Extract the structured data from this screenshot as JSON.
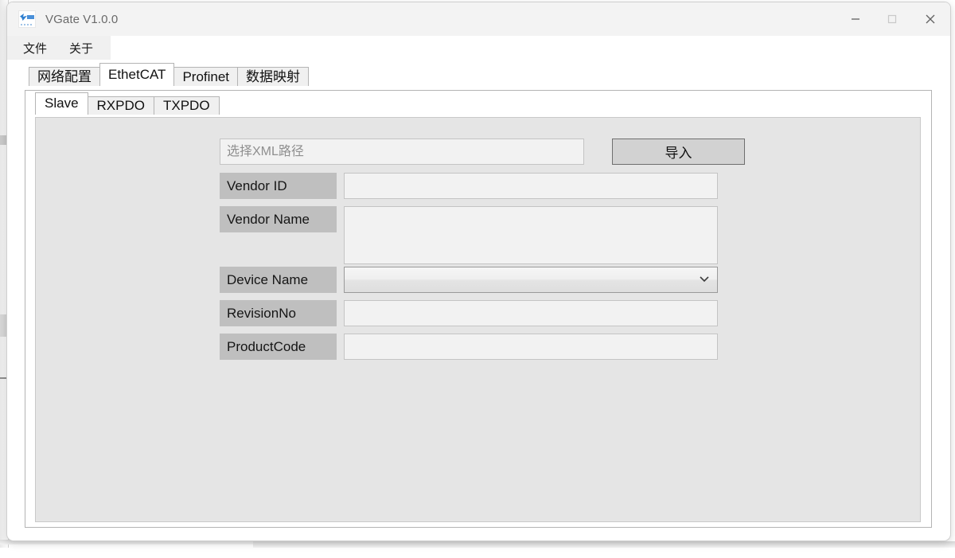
{
  "window": {
    "title": "VGate V1.0.0",
    "icon": "app-logo-icon",
    "controls": {
      "minimize": "minimize-icon",
      "maximize": "maximize-icon",
      "close": "close-icon"
    }
  },
  "menu": {
    "items": [
      {
        "label": "文件"
      },
      {
        "label": "关于"
      }
    ]
  },
  "tabs_outer": {
    "active": "EthetCAT",
    "items": [
      {
        "label": "网络配置"
      },
      {
        "label": "EthetCAT"
      },
      {
        "label": "Profinet"
      },
      {
        "label": "数据映射"
      }
    ]
  },
  "tabs_inner": {
    "active": "Slave",
    "items": [
      {
        "label": "Slave"
      },
      {
        "label": "RXPDO"
      },
      {
        "label": "TXPDO"
      }
    ]
  },
  "form": {
    "xml_path": {
      "placeholder": "选择XML路径",
      "value": ""
    },
    "import_button": "导入",
    "fields": [
      {
        "label": "Vendor ID",
        "value": "",
        "placeholder": "",
        "type": "text"
      },
      {
        "label": "Vendor Name",
        "value": "",
        "placeholder": "",
        "type": "textarea"
      },
      {
        "label": "Device Name",
        "value": "",
        "placeholder": "",
        "type": "select",
        "selected": ""
      },
      {
        "label": "RevisionNo",
        "value": "",
        "placeholder": "",
        "type": "text"
      },
      {
        "label": "ProductCode",
        "value": "",
        "placeholder": "",
        "type": "text"
      }
    ]
  },
  "colors": {
    "label_bg": "#bfbfbf",
    "input_bg": "#f2f2f2",
    "panel_bg": "#e5e5e5",
    "button_bg": "#d2d2d2",
    "titlebar_bg": "#f3f3f3"
  }
}
